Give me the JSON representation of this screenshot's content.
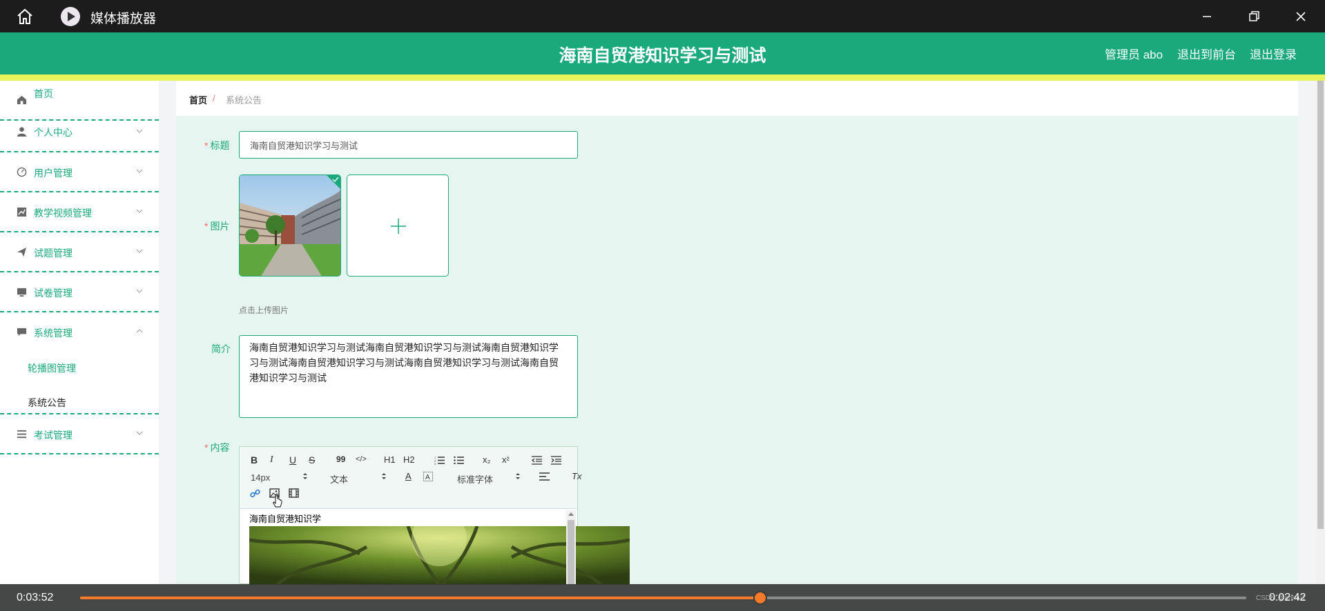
{
  "window": {
    "app_name": "媒体播放器"
  },
  "header": {
    "title": "海南自贸港知识学习与测试",
    "user": "管理员 abo",
    "to_front": "退出到前台",
    "logout": "退出登录"
  },
  "sidebar": {
    "items": [
      {
        "label": "首页",
        "icon": "home-icon"
      },
      {
        "label": "个人中心",
        "icon": "user-icon"
      },
      {
        "label": "用户管理",
        "icon": "gauge-icon"
      },
      {
        "label": "教学视频管理",
        "icon": "chart-icon"
      },
      {
        "label": "试题管理",
        "icon": "send-icon"
      },
      {
        "label": "试卷管理",
        "icon": "monitor-icon"
      },
      {
        "label": "系统管理",
        "icon": "chat-icon"
      },
      {
        "label": "考试管理",
        "icon": "list-icon"
      }
    ],
    "sub_items": [
      {
        "label": "轮播图管理"
      },
      {
        "label": "系统公告"
      }
    ]
  },
  "breadcrumb": {
    "home": "首页",
    "separator": "/",
    "current": "系统公告"
  },
  "form": {
    "title_label": "标题",
    "title_value": "海南自贸港知识学习与测试",
    "image_label": "图片",
    "upload_tip": "点击上传图片",
    "intro_label": "简介",
    "intro_value": "海南自贸港知识学习与测试海南自贸港知识学习与测试海南自贸港知识学习与测试海南自贸港知识学习与测试海南自贸港知识学习与测试海南自贸港知识学习与测试",
    "content_label": "内容",
    "required_mark": "*"
  },
  "editor": {
    "font_size": "14px",
    "block_format": "文本",
    "font_family": "标准字体",
    "body_text": "海南自贸港知识学",
    "buttons": {
      "bold": "B",
      "italic": "I",
      "underline": "U",
      "strike": "S",
      "quote": "99",
      "code": "</>",
      "h1": "H1",
      "h2": "H2",
      "sub": "x₂",
      "sup": "x²",
      "color": "A",
      "clear": "Tx"
    }
  },
  "player": {
    "elapsed": "0:03:52",
    "remaining": "0:02:42",
    "progress": 0.583,
    "watermark": "CSDN @anmu1",
    "accent": "#f47a2a"
  },
  "colors": {
    "primary": "#1aa97a",
    "accent_bar": "#e8f25a",
    "titlebar": "#1c1c1c"
  }
}
